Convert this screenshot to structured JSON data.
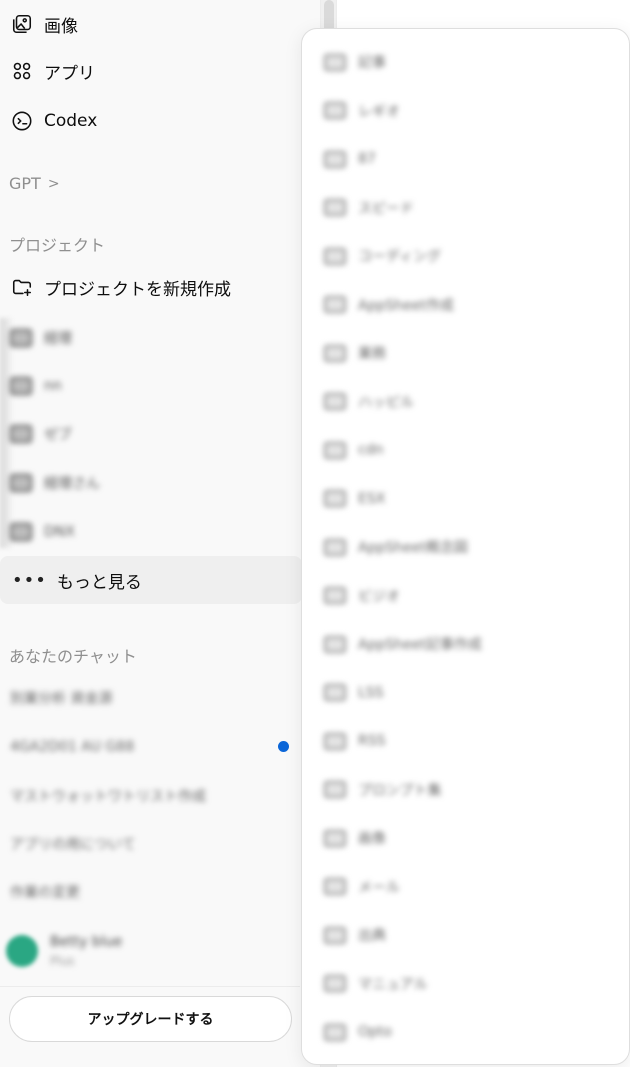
{
  "sidebar": {
    "nav": {
      "images": "画像",
      "apps": "アプリ",
      "codex": "Codex"
    },
    "gpt_label": "GPT",
    "projects_label": "プロジェクト",
    "new_project": "プロジェクトを新規作成",
    "projects": [
      "経理",
      "nn",
      "ゼブ",
      "経理さん",
      "DNX"
    ],
    "more": "もっと見る",
    "chats_label": "あなたのチャット",
    "chats": [
      "別業分析 資金源",
      "4GA2D01 AU G88",
      "マストウォットワトリスト作成",
      "アプリの用について",
      "作業の変更"
    ],
    "profile": {
      "name": "Betty blue",
      "plan": "Plus"
    },
    "upgrade": "アップグレードする"
  },
  "popup": {
    "items": [
      "記事",
      "レギオ",
      "87",
      "スピード",
      "コーディング",
      "AppSheet作成",
      "業務",
      "ハッピル",
      "cdn",
      "ESX",
      "AppSheet概念図",
      "ビジオ",
      "AppSheet記事作成",
      "LSS",
      "RSS",
      "プロンプト集",
      "画像",
      "メール",
      "出典",
      "マニュアル",
      "Opto"
    ]
  },
  "colors": {
    "unread_dot": "#0b66d8",
    "avatar": "#2aa783"
  }
}
